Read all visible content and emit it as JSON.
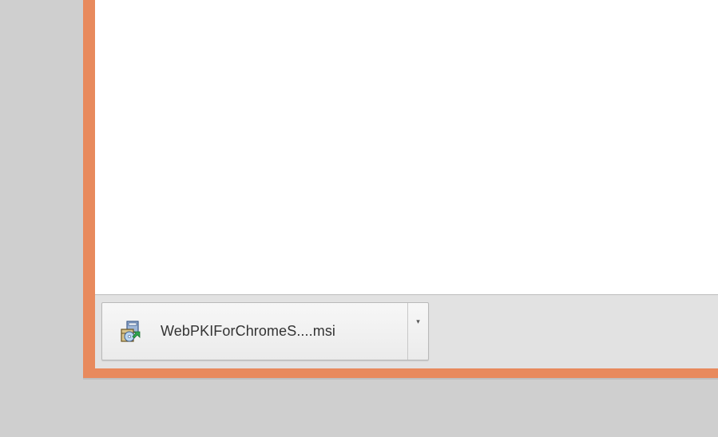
{
  "download_shelf": {
    "item": {
      "filename": "WebPKIForChromeS....msi",
      "icon": "installer-package-icon",
      "menu_icon": "chevron-down-icon",
      "menu_glyph": "▾"
    }
  },
  "colors": {
    "window_frame": "#e88a5d",
    "desktop": "#cfcfcf",
    "shelf": "#e2e2e2",
    "page": "#ffffff"
  }
}
